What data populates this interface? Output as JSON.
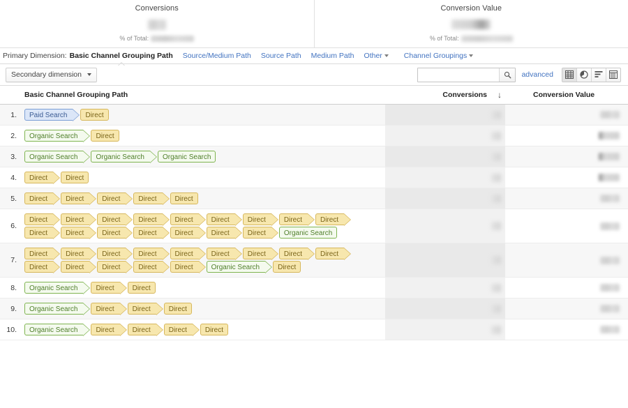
{
  "summary": {
    "metrics": [
      {
        "title": "Conversions",
        "value": "",
        "pct_label": "% of Total:",
        "pct_value": ""
      },
      {
        "title": "Conversion Value",
        "value": "",
        "pct_label": "% of Total:",
        "pct_value": ""
      }
    ]
  },
  "primary_dimension": {
    "label": "Primary Dimension:",
    "active": "Basic Channel Grouping Path",
    "links": [
      {
        "text": "Source/Medium Path",
        "caret": false
      },
      {
        "text": "Source Path",
        "caret": false
      },
      {
        "text": "Medium Path",
        "caret": false
      },
      {
        "text": "Other",
        "caret": true
      },
      {
        "text": "Channel Groupings",
        "caret": true
      }
    ]
  },
  "toolbar": {
    "secondary_dimension_label": "Secondary dimension",
    "search_value": "",
    "search_placeholder": "",
    "search_icon": "search-icon",
    "advanced_label": "advanced",
    "view_icons": [
      {
        "name": "table-view-icon",
        "active": true
      },
      {
        "name": "pie-chart-view-icon",
        "active": false
      },
      {
        "name": "performance-view-icon",
        "active": false
      },
      {
        "name": "pivot-view-icon",
        "active": false
      }
    ]
  },
  "table": {
    "columns": {
      "path": "Basic Channel Grouping Path",
      "conversions": "Conversions",
      "conversion_value": "Conversion Value"
    },
    "sort": {
      "column": "conversions",
      "direction": "desc",
      "glyph": "↓"
    },
    "rows": [
      {
        "index": "1.",
        "conversions": "",
        "conversion_value": "",
        "lines": [
          [
            "Paid Search",
            "Direct"
          ]
        ]
      },
      {
        "index": "2.",
        "conversions": "",
        "conversion_value": "",
        "lines": [
          [
            "Organic Search",
            "Direct"
          ]
        ]
      },
      {
        "index": "3.",
        "conversions": "",
        "conversion_value": "",
        "lines": [
          [
            "Organic Search",
            "Organic Search",
            "Organic Search"
          ]
        ]
      },
      {
        "index": "4.",
        "conversions": "",
        "conversion_value": "",
        "lines": [
          [
            "Direct",
            "Direct"
          ]
        ]
      },
      {
        "index": "5.",
        "conversions": "",
        "conversion_value": "",
        "lines": [
          [
            "Direct",
            "Direct",
            "Direct",
            "Direct",
            "Direct"
          ]
        ]
      },
      {
        "index": "6.",
        "conversions": "",
        "conversion_value": "",
        "lines": [
          [
            "Direct",
            "Direct",
            "Direct",
            "Direct",
            "Direct",
            "Direct",
            "Direct",
            "Direct",
            "Direct"
          ],
          [
            "Direct",
            "Direct",
            "Direct",
            "Direct",
            "Direct",
            "Direct",
            "Direct",
            "Organic Search"
          ]
        ]
      },
      {
        "index": "7.",
        "conversions": "",
        "conversion_value": "",
        "lines": [
          [
            "Direct",
            "Direct",
            "Direct",
            "Direct",
            "Direct",
            "Direct",
            "Direct",
            "Direct",
            "Direct"
          ],
          [
            "Direct",
            "Direct",
            "Direct",
            "Direct",
            "Direct",
            "Organic Search",
            "Direct"
          ]
        ]
      },
      {
        "index": "8.",
        "conversions": "",
        "conversion_value": "",
        "lines": [
          [
            "Organic Search",
            "Direct",
            "Direct"
          ]
        ]
      },
      {
        "index": "9.",
        "conversions": "",
        "conversion_value": "",
        "lines": [
          [
            "Organic Search",
            "Direct",
            "Direct",
            "Direct"
          ]
        ]
      },
      {
        "index": "10.",
        "conversions": "",
        "conversion_value": "",
        "lines": [
          [
            "Organic Search",
            "Direct",
            "Direct",
            "Direct",
            "Direct"
          ]
        ]
      }
    ]
  },
  "channel_colors": {
    "Direct": {
      "fill": "#f7e7ae",
      "border": "#d6b75c",
      "text": "#7a6418"
    },
    "Organic Search": {
      "fill": "#f4faee",
      "border": "#7fb450",
      "text": "#4f7f2a"
    },
    "Paid Search": {
      "fill": "#dbe6f8",
      "border": "#7b9fd6",
      "text": "#3c5c94"
    }
  }
}
